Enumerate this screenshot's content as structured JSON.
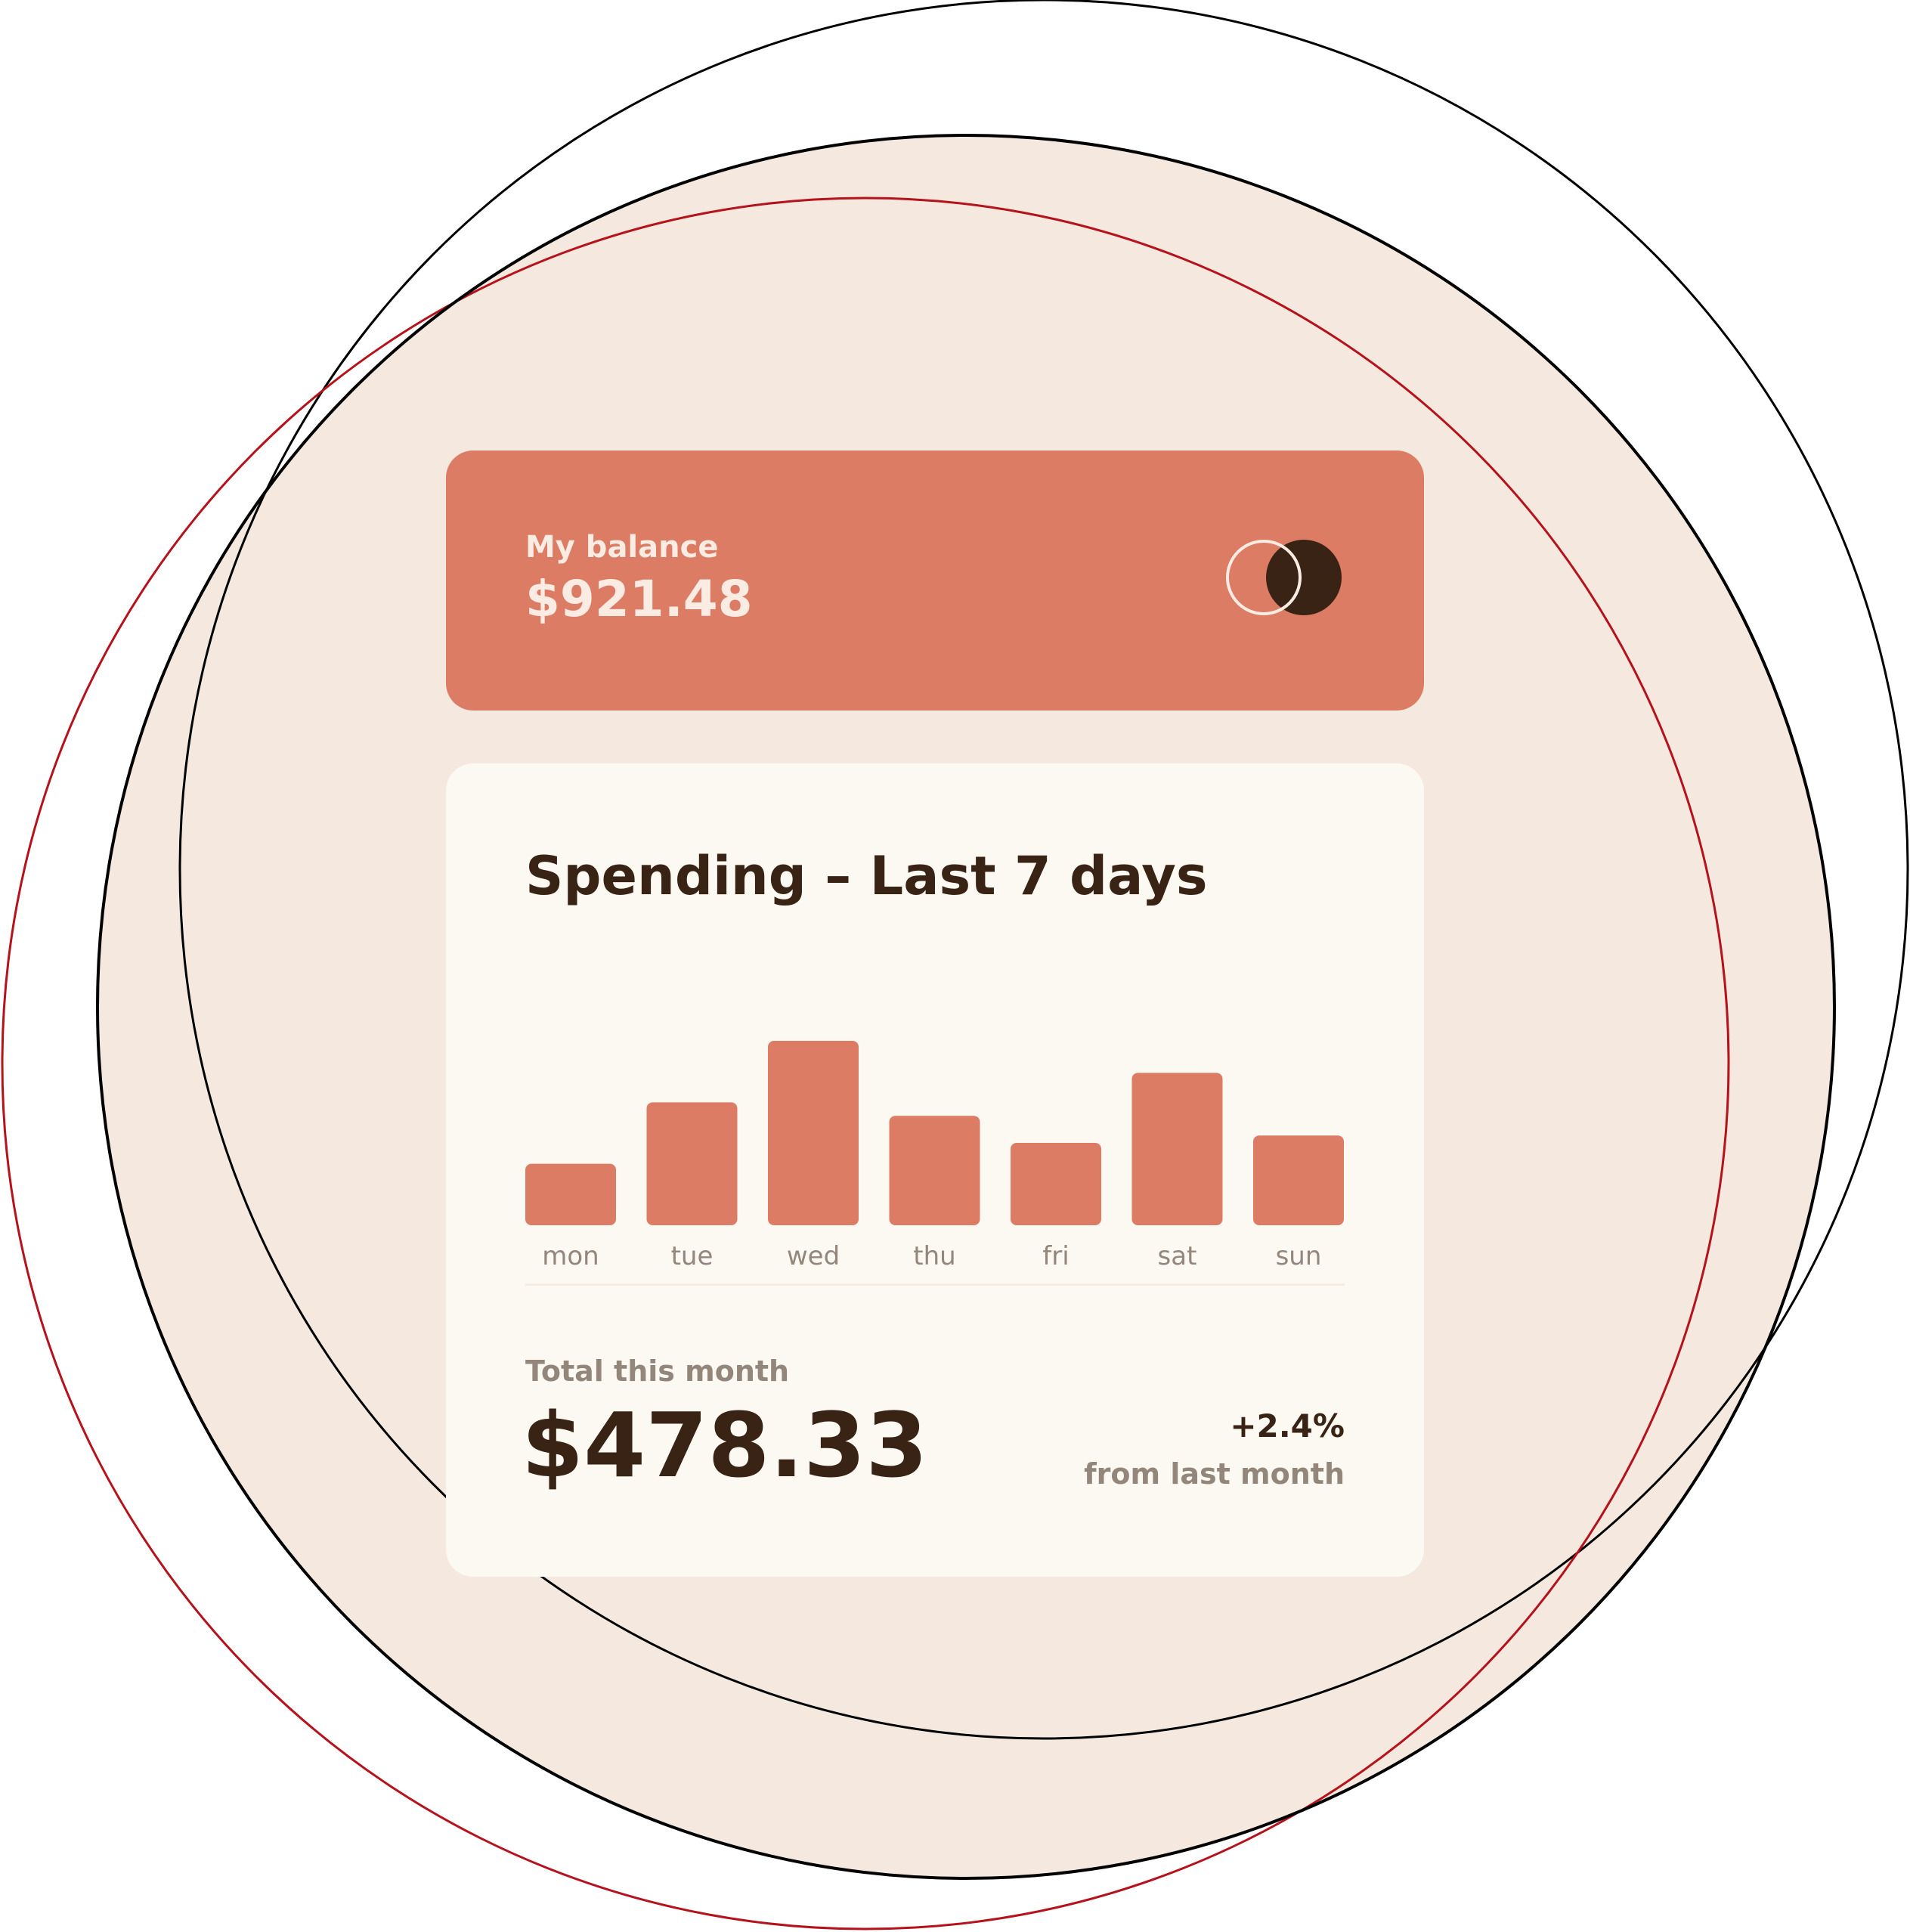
{
  "balance": {
    "label": "My balance",
    "amount": "$921.48",
    "logo_icon": "card-brand-logo-icon"
  },
  "spending": {
    "title": "Spending – Last 7 days",
    "total_label": "Total this month",
    "total_amount": "$478.33",
    "change_value": "+2.4%",
    "change_caption": "from last month"
  },
  "colors": {
    "background_circle": "#f5e9df",
    "accent_bar": "#dc7c64",
    "card": "#fcf8f2",
    "dark_text": "#382314",
    "muted_text": "#93867b",
    "ring_black": "#000000",
    "ring_red": "#b5121b"
  },
  "chart_data": {
    "type": "bar",
    "categories": [
      "mon",
      "tue",
      "wed",
      "thu",
      "fri",
      "sat",
      "sun"
    ],
    "values": [
      17.45,
      34.91,
      52.36,
      31.07,
      23.39,
      43.28,
      25.48
    ],
    "ylim": [
      0,
      52.36
    ],
    "grid": false
  }
}
